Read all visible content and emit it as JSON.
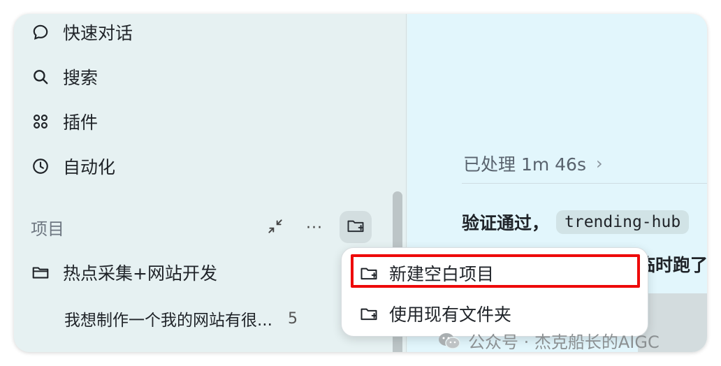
{
  "sidebar": {
    "nav": [
      {
        "label": "快速对话",
        "icon": "chat-bubble-icon"
      },
      {
        "label": "搜索",
        "icon": "search-icon"
      },
      {
        "label": "插件",
        "icon": "plugins-grid-icon"
      },
      {
        "label": "自动化",
        "icon": "clock-icon"
      }
    ],
    "section_label": "项目",
    "more_label": "···",
    "project": {
      "name": "热点采集+网站开发",
      "icon": "folder-icon"
    },
    "chat": {
      "title": "我想制作一个我的网站有很...",
      "time": "5"
    }
  },
  "main": {
    "processed_label": "已处理 1m 46s",
    "chevron": "›",
    "verify_text": "验证通过，",
    "code": "trending-hub",
    "partial_text": "临时跑了"
  },
  "menu": {
    "items": [
      {
        "label": "新建空白项目",
        "icon": "folder-plus-icon"
      },
      {
        "label": "使用现有文件夹",
        "icon": "folder-plus-icon"
      }
    ]
  },
  "watermark": {
    "text": "公众号 · 杰克船长的AIGC"
  },
  "colors": {
    "highlight": "#ee0a0a",
    "sidebar_bg": "#e6f1f2",
    "main_bg": "#e2f6fc"
  }
}
